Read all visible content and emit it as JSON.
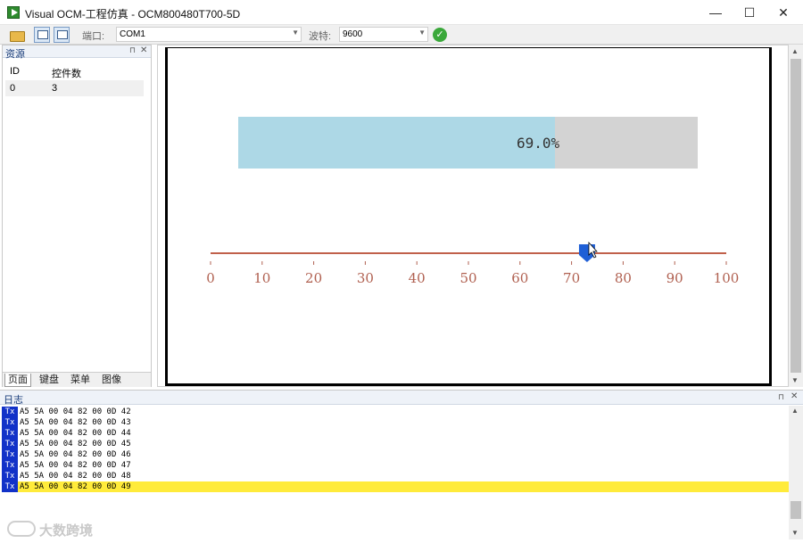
{
  "window": {
    "title": "Visual OCM-工程仿真 - OCM800480T700-5D"
  },
  "window_controls": {
    "minimize": "—",
    "maximize": "☐",
    "close": "✕"
  },
  "toolbar": {
    "port_label": "端口:",
    "port_value": "COM1",
    "baud_label": "波特:",
    "baud_value": "9600",
    "connect_glyph": "✓"
  },
  "resource_panel": {
    "title": "资源",
    "pin_glyph": "⊓",
    "close_glyph": "✕",
    "columns": [
      "ID",
      "控件数"
    ],
    "rows": [
      {
        "id": "0",
        "count": "3"
      }
    ],
    "tabs": [
      "页面",
      "键盘",
      "菜单",
      "图像"
    ],
    "active_tab": "页面"
  },
  "canvas": {
    "progress": {
      "value": 0.69,
      "label": "69.0%"
    },
    "slider": {
      "min": 0,
      "max": 100,
      "value": 73,
      "ticks": [
        "0",
        "10",
        "20",
        "30",
        "40",
        "50",
        "60",
        "70",
        "80",
        "90",
        "100"
      ],
      "track_color": "#c0604a",
      "label_color": "#b06050",
      "thumb_color": "#1f5fd6"
    },
    "progress_fill_color": "#add8e6",
    "progress_track_color": "#d3d3d3"
  },
  "log_panel": {
    "title": "日志",
    "pin_glyph": "⊓",
    "close_glyph": "✕",
    "lines": [
      {
        "dir": "Tx",
        "text": "A5 5A 00 04 82 00 0D 42",
        "highlight": false
      },
      {
        "dir": "Tx",
        "text": "A5 5A 00 04 82 00 0D 43",
        "highlight": false
      },
      {
        "dir": "Tx",
        "text": "A5 5A 00 04 82 00 0D 44",
        "highlight": false
      },
      {
        "dir": "Tx",
        "text": "A5 5A 00 04 82 00 0D 45",
        "highlight": false
      },
      {
        "dir": "Tx",
        "text": "A5 5A 00 04 82 00 0D 46",
        "highlight": false
      },
      {
        "dir": "Tx",
        "text": "A5 5A 00 04 82 00 0D 47",
        "highlight": false
      },
      {
        "dir": "Tx",
        "text": "A5 5A 00 04 82 00 0D 48",
        "highlight": false
      },
      {
        "dir": "Tx",
        "text": "A5 5A 00 04 82 00 0D 49",
        "highlight": true
      }
    ]
  },
  "watermark": {
    "text": "大数跨境"
  }
}
